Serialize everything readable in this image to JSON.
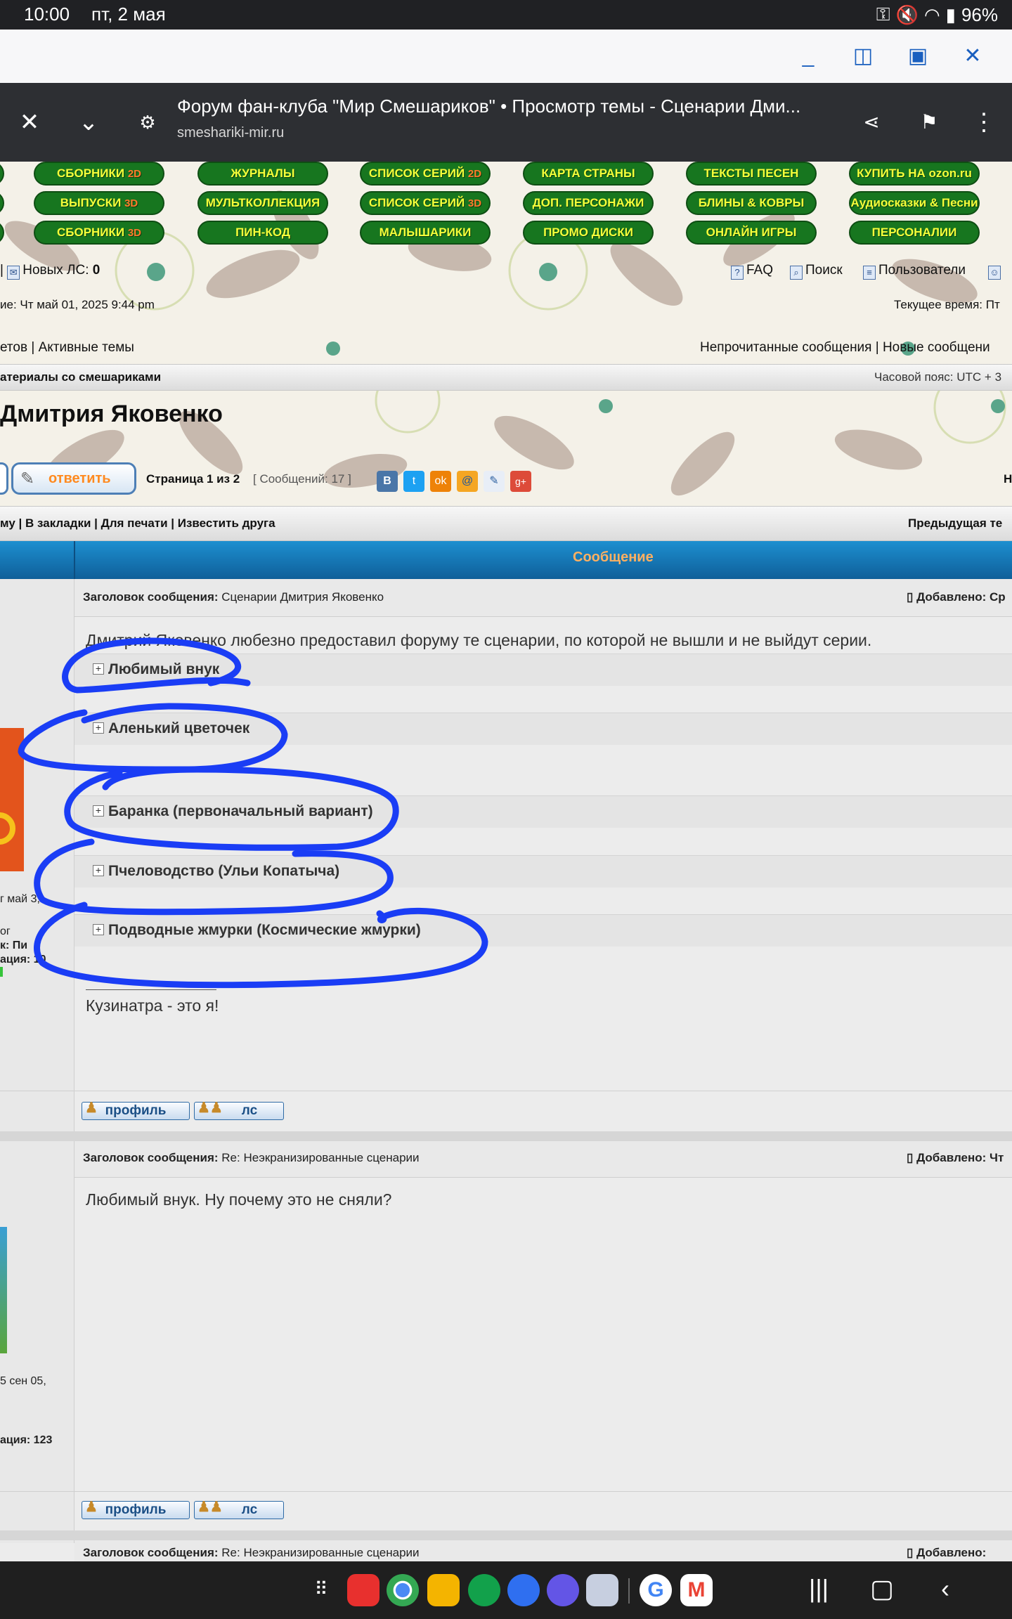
{
  "status_bar": {
    "time": "10:00",
    "date": "пт, 2 мая",
    "battery": "96%"
  },
  "browser": {
    "page_title": "Форум фан-клуба \"Мир Смешариков\" • Просмотр темы - Сценарии Дми...",
    "url": "smeshariki-mir.ru"
  },
  "nav_buttons": [
    {
      "text": "СБОРНИКИ ",
      "accent": "2D"
    },
    {
      "text": "ЖУРНАЛЫ",
      "accent": ""
    },
    {
      "text": "СПИСОК СЕРИЙ ",
      "accent": "2D"
    },
    {
      "text": "КАРТА СТРАНЫ",
      "accent": ""
    },
    {
      "text": "ТЕКСТЫ ПЕСЕН",
      "accent": ""
    },
    {
      "text": "КУПИТЬ НА ozon.ru",
      "accent": ""
    },
    {
      "text": "ВЫПУСКИ ",
      "accent": "3D"
    },
    {
      "text": "МУЛЬТКОЛЛЕКЦИЯ",
      "accent": ""
    },
    {
      "text": "СПИСОК СЕРИЙ ",
      "accent": "3D"
    },
    {
      "text": "ДОП. ПЕРСОНАЖИ",
      "accent": ""
    },
    {
      "text": "БЛИНЫ & КОВРЫ",
      "accent": ""
    },
    {
      "text": "Аудиосказки & Песни",
      "accent": ""
    },
    {
      "text": "СБОРНИКИ ",
      "accent": "3D"
    },
    {
      "text": "ПИН-КОД",
      "accent": ""
    },
    {
      "text": "МАЛЫШАРИКИ",
      "accent": ""
    },
    {
      "text": "ПРОМО ДИСКИ",
      "accent": ""
    },
    {
      "text": "ОНЛАЙН ИГРЫ",
      "accent": ""
    },
    {
      "text": "ПЕРСОНАЛИИ",
      "accent": ""
    }
  ],
  "header": {
    "new_pm_label": "Новых ЛС: ",
    "new_pm_count": "0",
    "faq": "FAQ",
    "search": "Поиск",
    "users": "Пользователи",
    "last_visit": "ие: Чт май 01, 2025 9:44 pm",
    "current_time": "Текущее время: Пт",
    "links_left": "етов | Активные темы",
    "links_right": "Непрочитанные сообщения | Новые сообщени"
  },
  "breadcrumb": {
    "forum": "атериалы со смешариками",
    "timezone": "Часовой пояс: UTC + 3"
  },
  "topic": {
    "title": "Дмитрия Яковенко",
    "reply_button": "ответить",
    "page_label": "Страница 1 из 2",
    "messages_count": "[ Сообщений: 17 ]",
    "right_cut": "Н",
    "tools": "му | В закладки | Для печати | Известить друга",
    "prev_topic": "Предыдущая те"
  },
  "message_header": "Сообщение",
  "posts": [
    {
      "subject_label": "Заголовок сообщения:",
      "subject": "Сценарии Дмитрия Яковенко",
      "added": "Добавлено: Ср",
      "text": "Дмитрий Яковенко любезно предоставил форуму те сценарии, по которой не вышли и не выйдут серии.",
      "spoilers": [
        "Любимый внук",
        "Аленький цветочек",
        "Баранка (первоначальный вариант)",
        "Пчеловодство (Ульи Копатыча)",
        "Подводные жмурки (Космические жмурки)"
      ],
      "signature": "Кузинатра - это я!",
      "side_info": [
        "г май 3,",
        "ог",
        "к: Пи",
        "ация: 10"
      ],
      "profile_btn": "профиль",
      "pm_btn": "лс"
    },
    {
      "subject_label": "Заголовок сообщения:",
      "subject": "Re: Неэкранизированные сценарии",
      "added": "Добавлено: Чт",
      "text": "Любимый внук. Ну почему это не сняли?",
      "side_info": [
        "5 сен 05,",
        "ация: 123"
      ],
      "profile_btn": "профиль",
      "pm_btn": "лс"
    },
    {
      "subject_label": "Заголовок сообщения:",
      "subject": "Re: Неэкранизированные сценарии",
      "added": "Добавлено:"
    }
  ],
  "colors": {
    "nav_green": "#17761f",
    "nav_text": "#f5ff3a",
    "msg_header": "#1d8fd0",
    "scribble": "#1a3df5"
  }
}
